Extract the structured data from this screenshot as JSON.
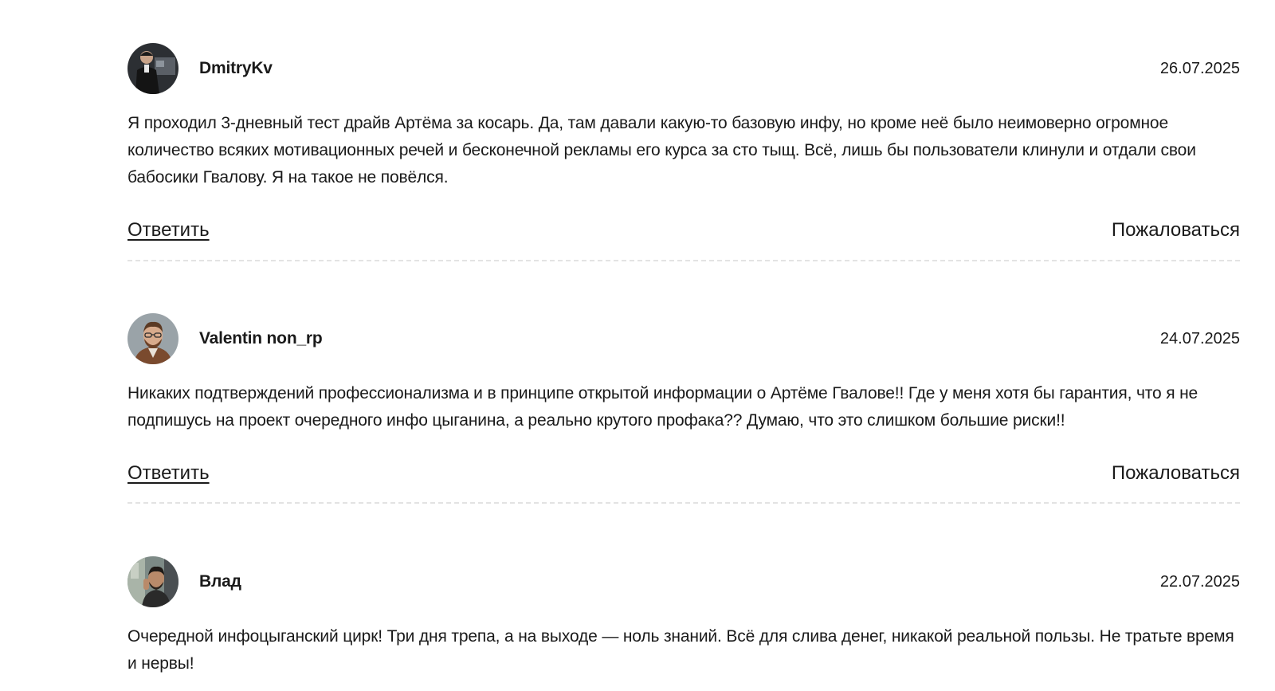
{
  "comments": [
    {
      "author": "DmitryKv",
      "date": "26.07.2025",
      "avatar_icon": "user-avatar-photo",
      "text": "Я проходил 3-дневный тест драйв Артёма за косарь. Да, там давали какую-то базовую инфу, но кроме неё было неимоверно огромное количество всяких мотивационных речей и бесконечной рекламы его курса за сто тыщ. Всё, лишь бы пользователи клинули и отдали свои бабосики Гвалову. Я на такое не повёлся.",
      "reply_label": "Ответить",
      "report_label": "Пожаловаться"
    },
    {
      "author": "Valentin non_rp",
      "date": "24.07.2025",
      "avatar_icon": "user-avatar-photo",
      "text": "Никаких подтверждений профессионализма и в принципе открытой информации о Артёме Гвалове!! Где у меня хотя бы гарантия, что я не подпишусь на проект очередного инфо цыганина, а реально крутого профака?? Думаю, что это слишком большие риски!!",
      "reply_label": "Ответить",
      "report_label": "Пожаловаться"
    },
    {
      "author": "Влад",
      "date": "22.07.2025",
      "avatar_icon": "user-avatar-photo",
      "text": "Очередной инфоцыганский цирк! Три дня трепа, а на выходе — ноль знаний. Всё для слива денег, никакой реальной пользы. Не тратьте время и нервы!"
    }
  ],
  "colors": {
    "text": "#1a1a1a",
    "divider": "#e3e3e3",
    "background": "#ffffff"
  }
}
